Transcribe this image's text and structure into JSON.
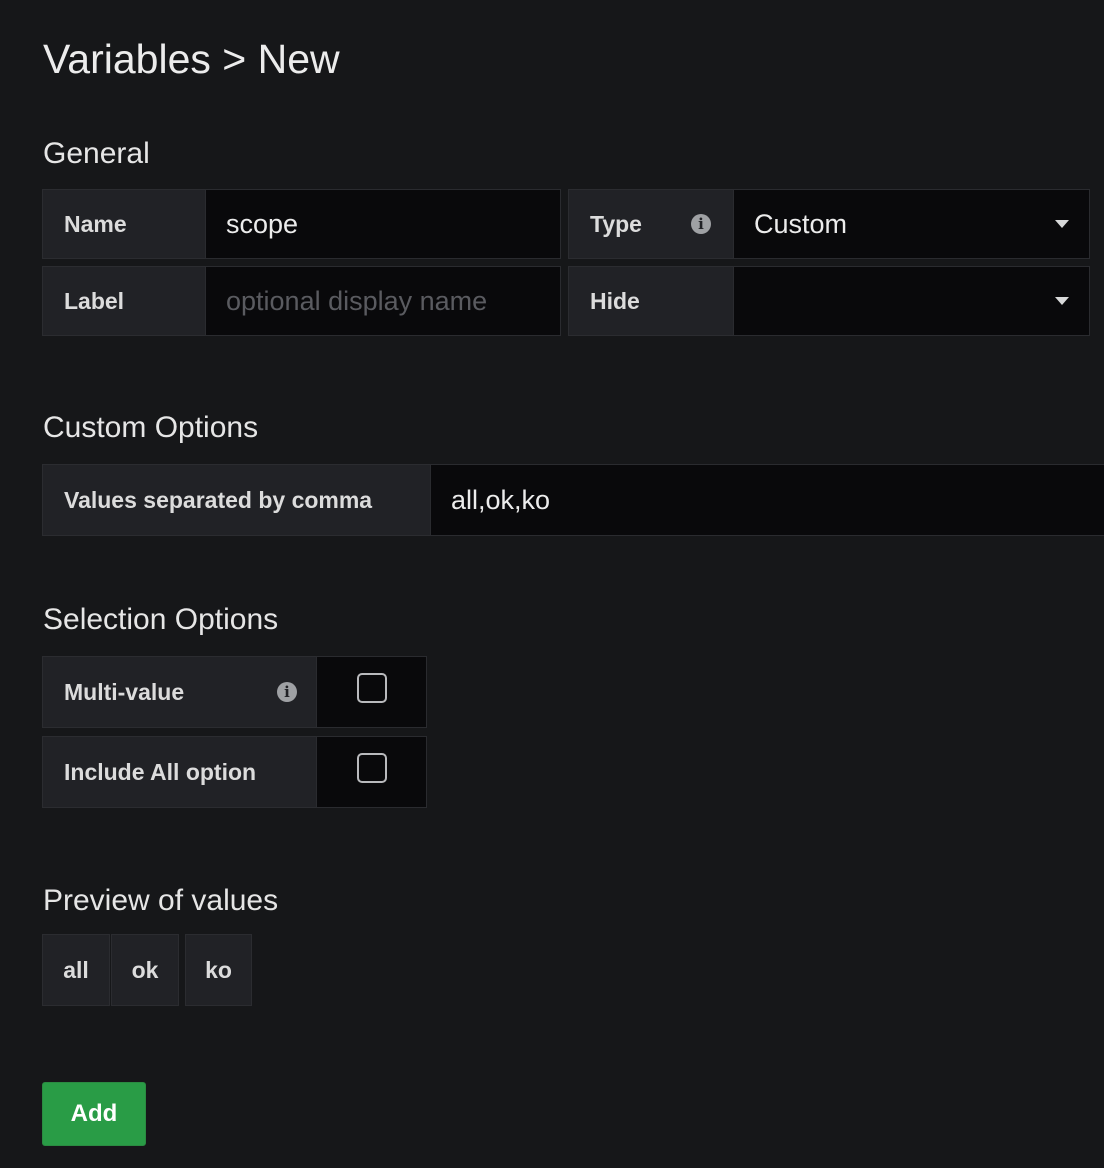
{
  "page": {
    "title": "Variables > New"
  },
  "general": {
    "heading": "General",
    "name_label": "Name",
    "name_value": "scope",
    "type_label": "Type",
    "type_value": "Custom",
    "label_label": "Label",
    "label_placeholder": "optional display name",
    "label_value": "",
    "hide_label": "Hide",
    "hide_value": ""
  },
  "custom_options": {
    "heading": "Custom Options",
    "values_label": "Values separated by comma",
    "values_value": "all,ok,ko"
  },
  "selection_options": {
    "heading": "Selection Options",
    "multi_value_label": "Multi-value",
    "multi_value_checked": false,
    "include_all_label": "Include All option",
    "include_all_checked": false
  },
  "preview": {
    "heading": "Preview of values",
    "values": [
      "all",
      "ok",
      "ko"
    ]
  },
  "actions": {
    "add_label": "Add"
  },
  "icons": {
    "info": "info-icon",
    "dropdown": "chevron-down-icon",
    "checkbox": "checkbox-icon"
  },
  "colors": {
    "background": "#161719",
    "label_bg": "#212226",
    "input_bg": "#09090b",
    "add_button": "#299c46"
  }
}
